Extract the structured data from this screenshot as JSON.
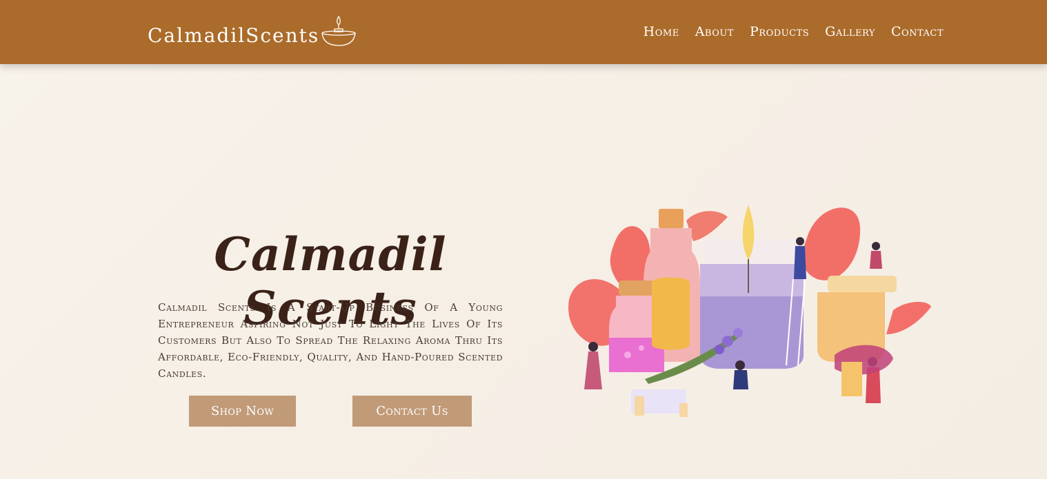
{
  "brand": {
    "name": "CalmadilScents",
    "logo_icon": "candle-bowl-icon"
  },
  "nav": {
    "items": [
      {
        "label": "Home"
      },
      {
        "label": "About"
      },
      {
        "label": "Products"
      },
      {
        "label": "Gallery"
      },
      {
        "label": "Contact"
      }
    ]
  },
  "hero": {
    "title": "Calmadil Scents",
    "description": "Calmadil Scents Is A Start-Up Business Of A Young Entrepreneur Aspiring Not Just To Light The Lives Of Its Customers But Also To Spread The Relaxing Aroma Thru Its Affordable, Eco-Friendly, Quality, And Hand-Poured Scented Candles.",
    "buttons": {
      "shop": "Shop Now",
      "contact": "Contact Us"
    },
    "illustration_icon": "candle-making-illustration"
  },
  "colors": {
    "navbar": "#ab6b2a",
    "button": "#c19a78",
    "title": "#3a2218",
    "background": "#f7f2ea"
  }
}
